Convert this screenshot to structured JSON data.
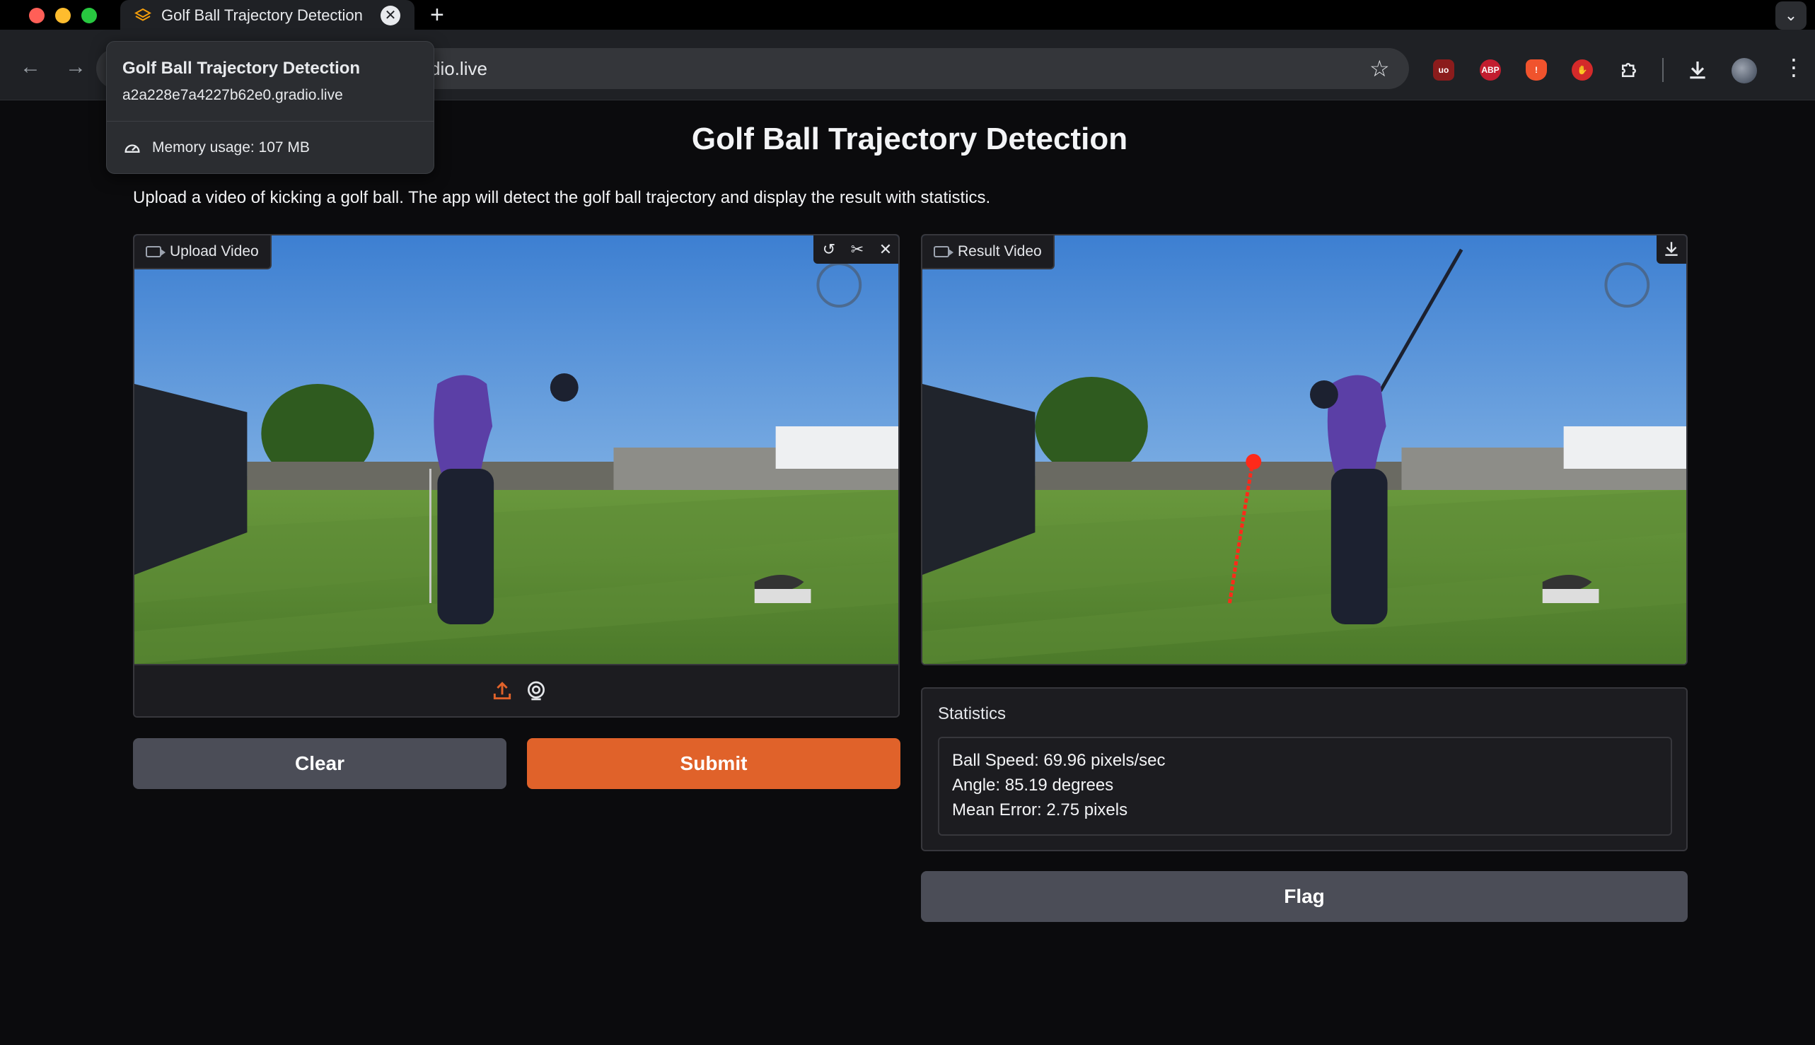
{
  "browser": {
    "tab_title": "Golf Ball Trajectory Detection",
    "url_visible": "dio.live",
    "hovercard": {
      "title": "Golf Ball Trajectory Detection",
      "url": "a2a228e7a4227b62e0.gradio.live",
      "memory": "Memory usage: 107 MB"
    },
    "extensions": [
      "uo",
      "ABP",
      "!",
      "✋"
    ]
  },
  "app": {
    "title": "Golf Ball Trajectory Detection",
    "description": "Upload a video of kicking a golf ball. The app will detect the golf ball trajectory and display the result with statistics.",
    "upload_label": "Upload Video",
    "result_label": "Result Video",
    "clear_label": "Clear",
    "submit_label": "Submit",
    "flag_label": "Flag",
    "statistics": {
      "label": "Statistics",
      "lines": [
        "Ball Speed: 69.96 pixels/sec",
        "Angle: 85.19 degrees",
        "Mean Error: 2.75 pixels"
      ]
    }
  },
  "colors": {
    "accent": "#e0622a",
    "secondary_button": "#4b4d57",
    "trajectory": "#ff2a1a"
  }
}
